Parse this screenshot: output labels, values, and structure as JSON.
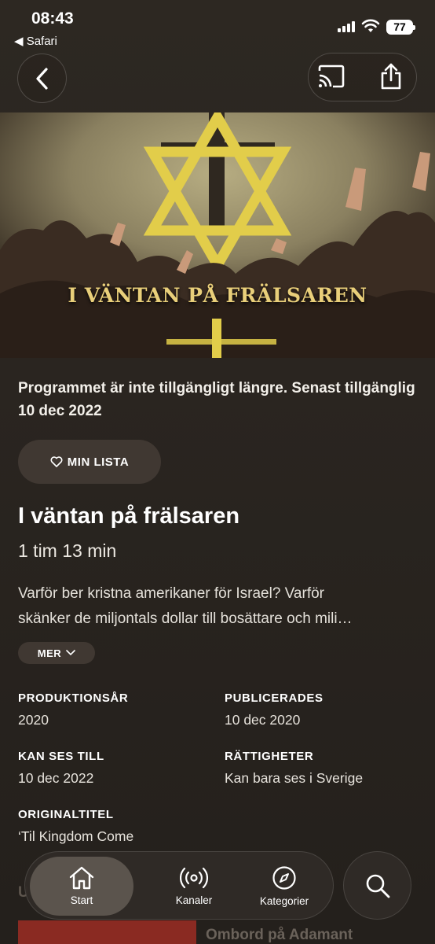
{
  "status": {
    "time": "08:43",
    "back_app": "◀ Safari",
    "battery": "77"
  },
  "hero": {
    "title": "I VÄNTAN PÅ FRÄLSAREN"
  },
  "notice": "Programmet är inte tillgängligt längre. Senast tillgänglig 10 dec 2022",
  "my_list_label": "MIN LISTA",
  "program": {
    "title": "I väntan på frälsaren",
    "duration": "1 tim 13 min",
    "description_line1": "Varför ber kristna amerikaner för Israel? Varför",
    "description_line2": "skänker de miljontals dollar till bosättare och mili…",
    "more_label": "MER"
  },
  "meta": [
    {
      "label": "PRODUKTIONSÅR",
      "value": "2020"
    },
    {
      "label": "PUBLICERADES",
      "value": "10 dec 2020"
    },
    {
      "label": "KAN SES TILL",
      "value": "10 dec 2022"
    },
    {
      "label": "RÄTTIGHETER",
      "value": "Kan bara ses i Sverige"
    },
    {
      "label": "ORIGINALTITEL",
      "value": "‘Til Kingdom Come"
    }
  ],
  "next": {
    "section_label": "U",
    "title": "Ombord på Adamant"
  },
  "tabs": [
    {
      "label": "Start",
      "icon": "home-icon"
    },
    {
      "label": "Kanaler",
      "icon": "broadcast-icon"
    },
    {
      "label": "Kategorier",
      "icon": "compass-icon"
    }
  ],
  "colors": {
    "background": "#2a2520",
    "accent_gold": "#e9cf7a",
    "button_bg": "#403832"
  }
}
